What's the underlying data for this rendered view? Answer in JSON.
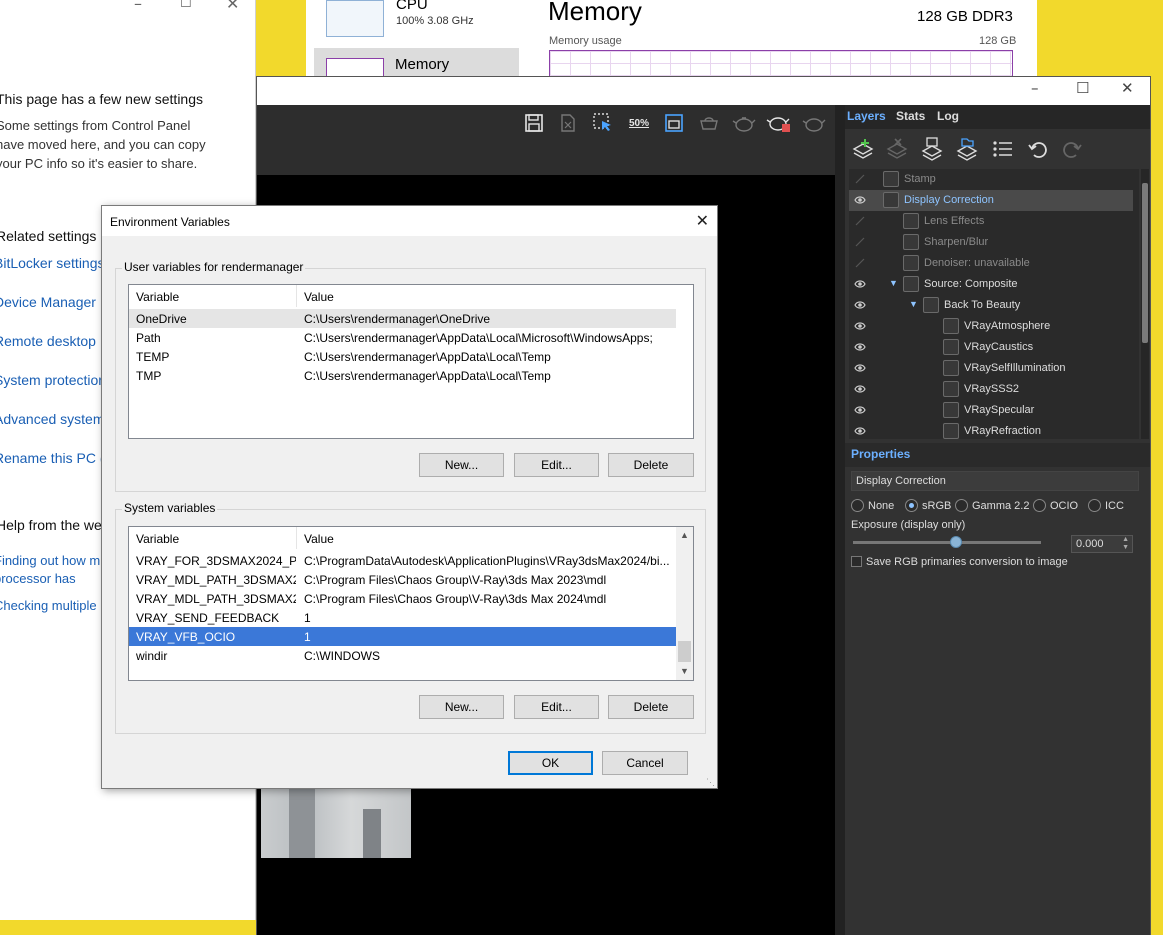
{
  "settings": {
    "heading": "This page has a few new settings",
    "desc_lines": [
      "Some settings from Control Panel",
      "have moved here, and you can copy",
      "your PC info so it's easier to share."
    ],
    "related_heading": "Related settings",
    "links": [
      "BitLocker settings",
      "Device Manager",
      "Remote desktop",
      "System protection",
      "Advanced system",
      "Rename this PC (a"
    ],
    "help_heading": "Help from the web",
    "help_links": [
      "Finding out how m",
      "processor has",
      "Checking multiple"
    ]
  },
  "taskmgr": {
    "cpu_label": "CPU",
    "cpu_value": "100% 3.08 GHz",
    "memory_label": "Memory",
    "title": "Memory",
    "memory_spec": "128 GB DDR3",
    "usage_label": "Memory usage",
    "usage_max": "128 GB"
  },
  "vfb": {
    "tabs": [
      "Layers",
      "Stats",
      "Log"
    ],
    "layers": [
      {
        "label": "Stamp",
        "indent": 0,
        "eye": false,
        "dimmed": true
      },
      {
        "label": "Display Correction",
        "indent": 0,
        "eye": true,
        "selected": true
      },
      {
        "label": "Lens Effects",
        "indent": 1,
        "eye": false,
        "dimmed": true
      },
      {
        "label": "Sharpen/Blur",
        "indent": 1,
        "eye": false,
        "dimmed": true
      },
      {
        "label": "Denoiser: unavailable",
        "indent": 1,
        "eye": false,
        "dimmed": true
      },
      {
        "label": "Source: Composite",
        "indent": 1,
        "eye": true,
        "expander": true
      },
      {
        "label": "Back To Beauty",
        "indent": 2,
        "eye": true,
        "expander": true
      },
      {
        "label": "VRayAtmosphere",
        "indent": 3,
        "eye": true
      },
      {
        "label": "VRayCaustics",
        "indent": 3,
        "eye": true
      },
      {
        "label": "VRaySelfIllumination",
        "indent": 3,
        "eye": true
      },
      {
        "label": "VRaySSS2",
        "indent": 3,
        "eye": true
      },
      {
        "label": "VRaySpecular",
        "indent": 3,
        "eye": true
      },
      {
        "label": "VRayRefraction",
        "indent": 3,
        "eye": true
      }
    ],
    "properties_heading": "Properties",
    "properties_field": "Display Correction",
    "radio_options": [
      "None",
      "sRGB",
      "Gamma 2.2",
      "OCIO",
      "ICC"
    ],
    "radio_selected": "sRGB",
    "exposure_label": "Exposure (display only)",
    "exposure_value": "0.000",
    "exposure_slider_fraction": 0.55,
    "save_rgb_label": "Save RGB primaries conversion to image",
    "save_rgb_checked": false,
    "zoom_label": "50%"
  },
  "envdlg": {
    "title": "Environment Variables",
    "user_group": "User variables for rendermanager",
    "system_group": "System variables",
    "col_variable": "Variable",
    "col_value": "Value",
    "user_vars": [
      {
        "name": "OneDrive",
        "value": "C:\\Users\\rendermanager\\OneDrive"
      },
      {
        "name": "Path",
        "value": "C:\\Users\\rendermanager\\AppData\\Local\\Microsoft\\WindowsApps;"
      },
      {
        "name": "TEMP",
        "value": "C:\\Users\\rendermanager\\AppData\\Local\\Temp"
      },
      {
        "name": "TMP",
        "value": "C:\\Users\\rendermanager\\AppData\\Local\\Temp"
      }
    ],
    "system_vars": [
      {
        "name": "VRAY_FOR_3DSMAX2024_PL...",
        "value": "C:\\ProgramData\\Autodesk\\ApplicationPlugins\\VRay3dsMax2024/bi..."
      },
      {
        "name": "VRAY_MDL_PATH_3DSMAX2...",
        "value": "C:\\Program Files\\Chaos Group\\V-Ray\\3ds Max 2023\\mdl"
      },
      {
        "name": "VRAY_MDL_PATH_3DSMAX2...",
        "value": "C:\\Program Files\\Chaos Group\\V-Ray\\3ds Max 2024\\mdl"
      },
      {
        "name": "VRAY_SEND_FEEDBACK",
        "value": "1"
      },
      {
        "name": "VRAY_VFB_OCIO",
        "value": "1"
      },
      {
        "name": "windir",
        "value": "C:\\WINDOWS"
      }
    ],
    "buttons": {
      "new": "New...",
      "edit": "Edit...",
      "delete": "Delete",
      "ok": "OK",
      "cancel": "Cancel"
    },
    "colors": {
      "selection": "#3b78d8",
      "accent": "#0078d7"
    }
  }
}
